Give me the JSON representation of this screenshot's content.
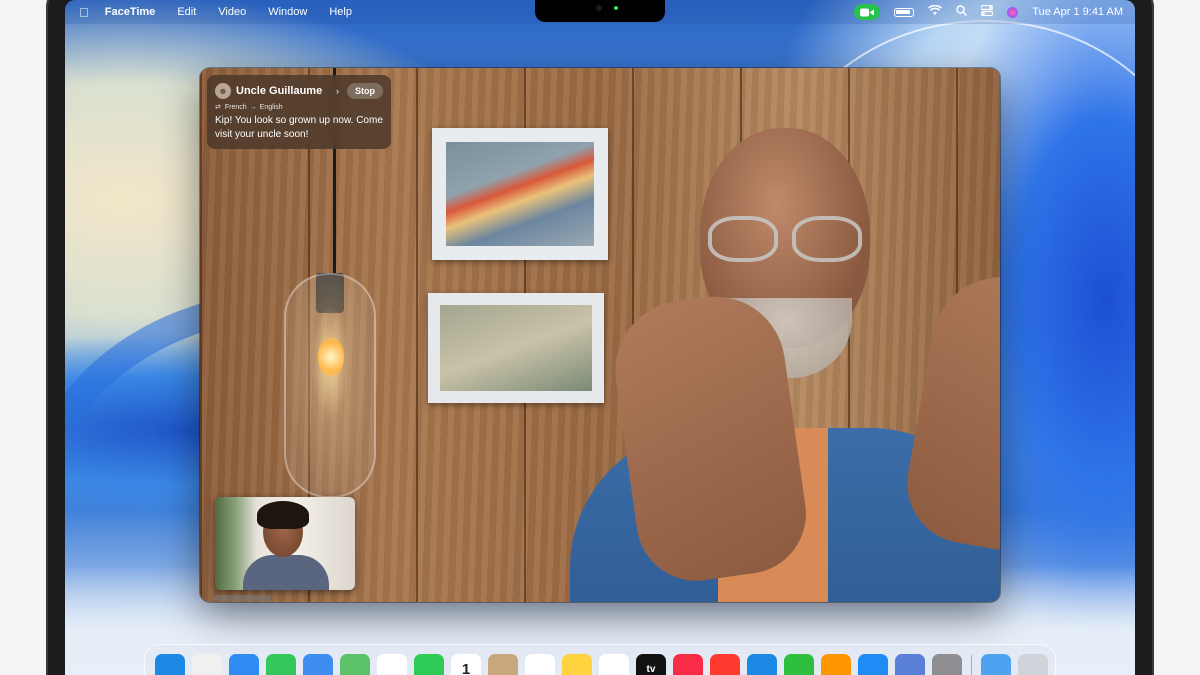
{
  "menubar": {
    "app_name": "FaceTime",
    "menus": [
      "Edit",
      "Video",
      "Window",
      "Help"
    ],
    "datetime": "Tue Apr 1  9:41 AM"
  },
  "live_translation": {
    "caller_name": "Uncle Guillaume",
    "stop_label": "Stop",
    "from_language": "French",
    "to_language": "English",
    "caption": "Kip! You look so grown up now. Come visit your uncle soon!"
  },
  "dock": {
    "apps": [
      {
        "name": "finder",
        "icon": "finder-icon",
        "color": "#1e88e5"
      },
      {
        "name": "launchpad",
        "icon": "launchpad-icon",
        "color": "#f0f0f0"
      },
      {
        "name": "safari",
        "icon": "safari-icon",
        "color": "#2f8cf2"
      },
      {
        "name": "messages",
        "icon": "messages-icon",
        "color": "#34c759"
      },
      {
        "name": "mail",
        "icon": "mail-icon",
        "color": "#3d8ef0"
      },
      {
        "name": "maps",
        "icon": "maps-icon",
        "color": "#5cc26a"
      },
      {
        "name": "photos",
        "icon": "photos-icon",
        "color": "#ffffff"
      },
      {
        "name": "facetime",
        "icon": "facetime-icon",
        "color": "#2ecc56"
      },
      {
        "name": "calendar",
        "icon": "calendar-icon",
        "color": "#ffffff",
        "text": "1"
      },
      {
        "name": "contacts",
        "icon": "contacts-icon",
        "color": "#c9a77e"
      },
      {
        "name": "reminders",
        "icon": "reminders-icon",
        "color": "#ffffff"
      },
      {
        "name": "notes",
        "icon": "notes-icon",
        "color": "#ffd23f"
      },
      {
        "name": "freeform",
        "icon": "freeform-icon",
        "color": "#ffffff"
      },
      {
        "name": "tv",
        "icon": "tv-icon",
        "color": "#111111",
        "text": "tv"
      },
      {
        "name": "music",
        "icon": "music-icon",
        "color": "#fa2d48"
      },
      {
        "name": "news",
        "icon": "news-icon",
        "color": "#ff3b30"
      },
      {
        "name": "keynote",
        "icon": "keynote-icon",
        "color": "#1e88e5"
      },
      {
        "name": "numbers",
        "icon": "numbers-icon",
        "color": "#2fbf3f"
      },
      {
        "name": "pages",
        "icon": "pages-icon",
        "color": "#ff9500"
      },
      {
        "name": "app-store",
        "icon": "app-store-icon",
        "color": "#1f8bf5"
      },
      {
        "name": "iphone-mirroring",
        "icon": "iphone-mirroring-icon",
        "color": "#5a7fd6"
      },
      {
        "name": "system-settings",
        "icon": "gear-icon",
        "color": "#8e8e93"
      }
    ],
    "folders": [
      {
        "name": "downloads",
        "icon": "downloads-folder-icon",
        "color": "#4da3f0"
      },
      {
        "name": "trash",
        "icon": "trash-icon",
        "color": "#d0d4da"
      }
    ]
  }
}
